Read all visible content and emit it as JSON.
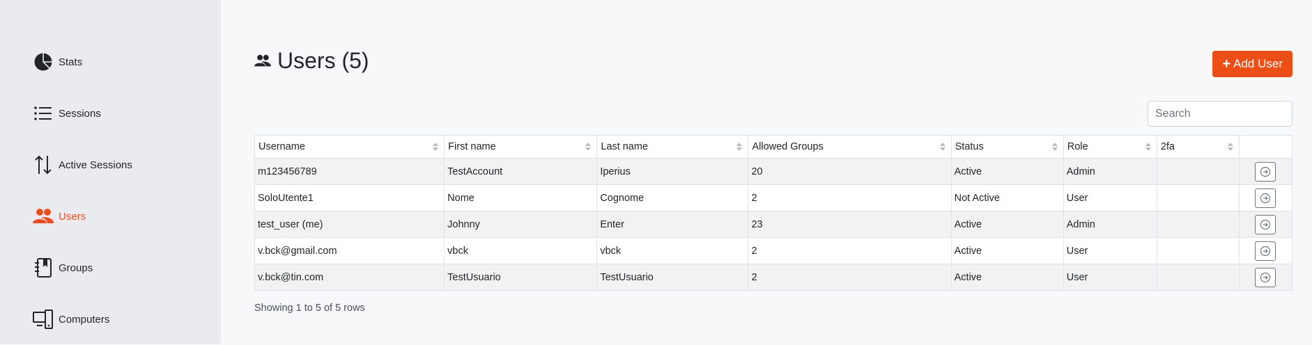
{
  "sidebar": {
    "items": [
      {
        "label": "Stats",
        "icon": "pie-chart-icon",
        "active": false
      },
      {
        "label": "Sessions",
        "icon": "list-icon",
        "active": false
      },
      {
        "label": "Active Sessions",
        "icon": "arrows-up-down-icon",
        "active": false
      },
      {
        "label": "Users",
        "icon": "users-icon",
        "active": true
      },
      {
        "label": "Groups",
        "icon": "journal-bookmark-icon",
        "active": false
      },
      {
        "label": "Computers",
        "icon": "devices-icon",
        "active": false
      }
    ]
  },
  "header": {
    "title": "Users (5)",
    "title_icon": "users-icon",
    "add_button_label": "Add User"
  },
  "search": {
    "placeholder": "Search",
    "value": ""
  },
  "table": {
    "columns": [
      "Username",
      "First name",
      "Last name",
      "Allowed Groups",
      "Status",
      "Role",
      "2fa",
      ""
    ],
    "rows": [
      [
        "m123456789",
        "TestAccount",
        "Iperius",
        "20",
        "Active",
        "Admin",
        ""
      ],
      [
        "SoloUtente1",
        "Nome",
        "Cognome",
        "2",
        "Not Active",
        "User",
        ""
      ],
      [
        "test_user (me)",
        "Johnny",
        "Enter",
        "23",
        "Active",
        "Admin",
        ""
      ],
      [
        "v.bck@gmail.com",
        "vbck",
        "vbck",
        "2",
        "Active",
        "User",
        ""
      ],
      [
        "v.bck@tin.com",
        "TestUsuario",
        "TestUsuario",
        "2",
        "Active",
        "User",
        ""
      ]
    ],
    "row_action_icon": "arrow-right-circle-icon"
  },
  "footer": {
    "info": "Showing 1 to 5 of 5 rows"
  },
  "colors": {
    "accent": "#ec4e17",
    "sidebar_bg": "#e9ebee",
    "page_bg": "#f7f8fa"
  }
}
